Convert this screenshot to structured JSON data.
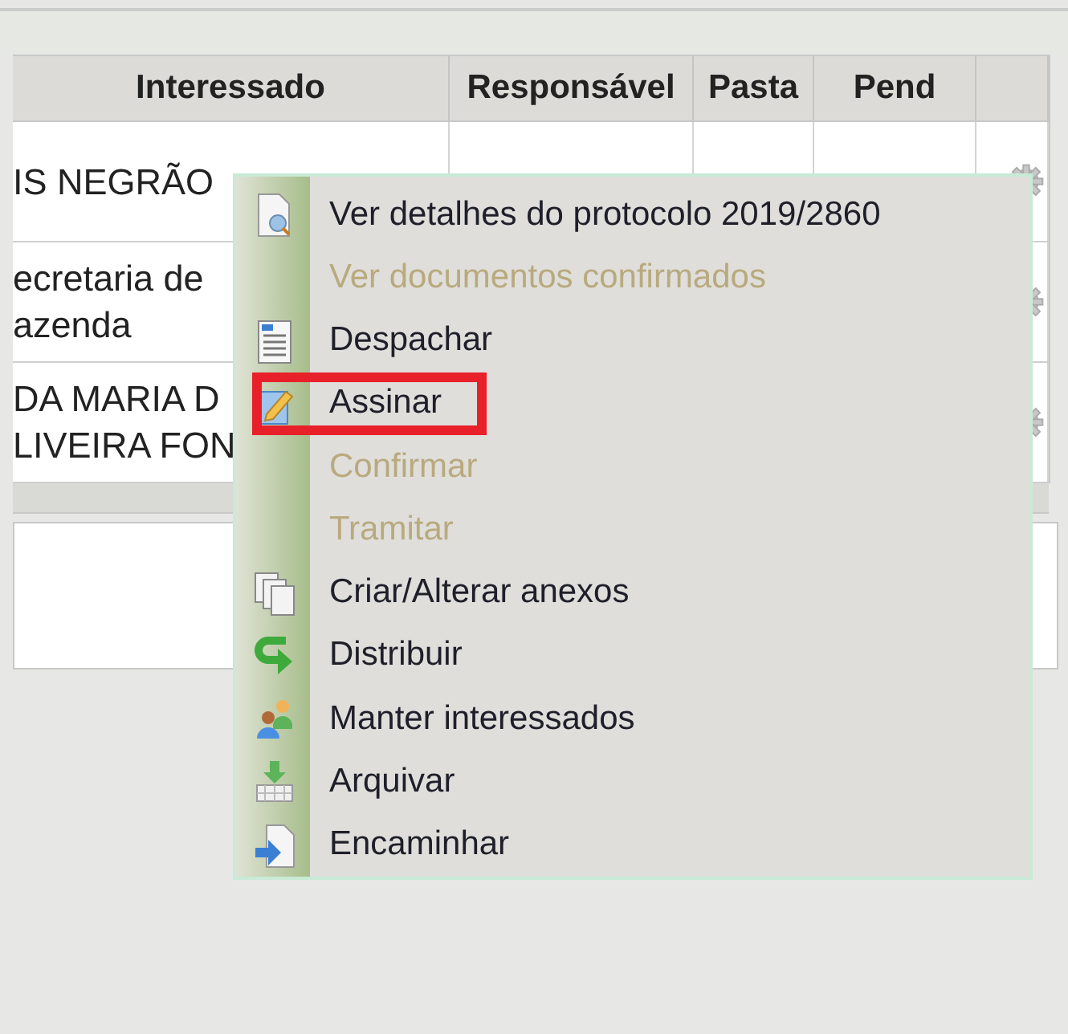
{
  "table": {
    "columns": [
      "Interessado",
      "Responsável",
      "Pasta",
      "Pend",
      ""
    ],
    "rows": [
      {
        "interessado": [
          "IS NEGRÃO"
        ]
      },
      {
        "interessado": [
          "ecretaria de",
          "azenda"
        ]
      },
      {
        "interessado": [
          "DA MARIA D",
          "LIVEIRA FON"
        ]
      }
    ]
  },
  "context_menu": {
    "items": [
      {
        "label": "Ver detalhes do protocolo 2019/2860",
        "disabled": false,
        "highlighted": false
      },
      {
        "label": "Ver documentos confirmados",
        "disabled": true,
        "highlighted": false
      },
      {
        "label": "Despachar",
        "disabled": false,
        "highlighted": false
      },
      {
        "label": "Assinar",
        "disabled": false,
        "highlighted": true
      },
      {
        "label": "Confirmar",
        "disabled": true,
        "highlighted": false
      },
      {
        "label": "Tramitar",
        "disabled": true,
        "highlighted": false
      },
      {
        "label": "Criar/Alterar anexos",
        "disabled": false,
        "highlighted": false
      },
      {
        "label": "Distribuir",
        "disabled": false,
        "highlighted": false
      },
      {
        "label": "Manter interessados",
        "disabled": false,
        "highlighted": false
      },
      {
        "label": "Arquivar",
        "disabled": false,
        "highlighted": false
      },
      {
        "label": "Encaminhar",
        "disabled": false,
        "highlighted": false
      }
    ]
  }
}
